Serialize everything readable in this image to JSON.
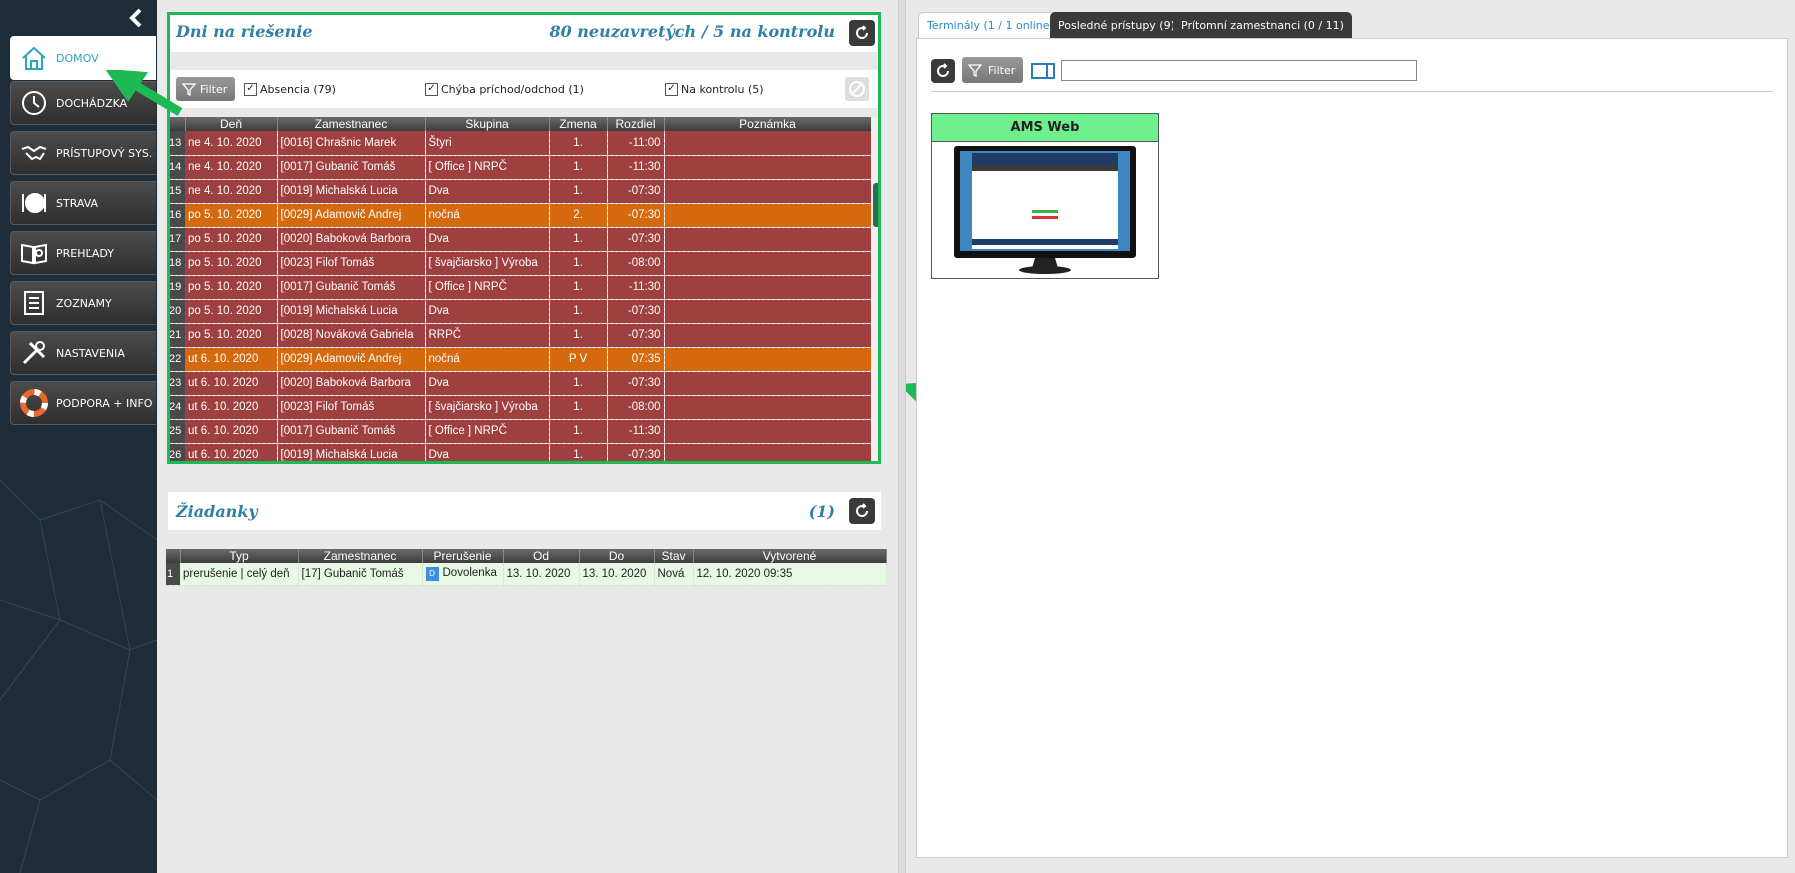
{
  "sidebar": {
    "items": [
      {
        "label": "DOMOV",
        "icon": "home-icon"
      },
      {
        "label": "DOCHÁDZKA",
        "icon": "clock-icon"
      },
      {
        "label": "PRÍSTUPOVÝ SYS.",
        "icon": "handshake-icon"
      },
      {
        "label": "STRAVA",
        "icon": "plate-icon"
      },
      {
        "label": "PREHĽADY",
        "icon": "book-search-icon"
      },
      {
        "label": "ZOZNAMY",
        "icon": "list-icon"
      },
      {
        "label": "NASTAVENIA",
        "icon": "tools-icon"
      },
      {
        "label": "PODPORA + INFO",
        "icon": "lifebuoy-icon"
      }
    ]
  },
  "days": {
    "title": "Dni na riešenie",
    "summary": "80 neuzavretých / 5 na kontrolu",
    "filter_label": "Filter",
    "checks": [
      {
        "label": "Absencia (79)",
        "checked": true
      },
      {
        "label": "Chýba príchod/odchod (1)",
        "checked": true
      },
      {
        "label": "Na kontrolu (5)",
        "checked": true
      }
    ],
    "columns": [
      "Deň",
      "Zamestnanec",
      "Skupina",
      "Zmena",
      "Rozdiel",
      "Poznámka"
    ],
    "rows": [
      {
        "n": "13",
        "day": "ne 4. 10. 2020",
        "emp": "[0016] Chrašnic Marek",
        "group": "Štyri",
        "shift": "1.",
        "diff": "-11:00",
        "note": "",
        "color": "red"
      },
      {
        "n": "14",
        "day": "ne 4. 10. 2020",
        "emp": "[0017] Gubanič Tomáš",
        "group": "[ Office ]  NRPČ",
        "shift": "1.",
        "diff": "-11:30",
        "note": "",
        "color": "red"
      },
      {
        "n": "15",
        "day": "ne 4. 10. 2020",
        "emp": "[0019] Michalská Lucia",
        "group": "Dva",
        "shift": "1.",
        "diff": "-07:30",
        "note": "",
        "color": "red"
      },
      {
        "n": "16",
        "day": "po 5. 10. 2020",
        "emp": "[0029] Adamovič Andrej",
        "group": "nočná",
        "shift": "2.",
        "diff": "-07:30",
        "note": "",
        "color": "orange"
      },
      {
        "n": "17",
        "day": "po 5. 10. 2020",
        "emp": "[0020] Baboková Barbora",
        "group": "Dva",
        "shift": "1.",
        "diff": "-07:30",
        "note": "",
        "color": "red"
      },
      {
        "n": "18",
        "day": "po 5. 10. 2020",
        "emp": "[0023] Filof Tomáš",
        "group": "[ švajčiarsko ]  Výroba",
        "shift": "1.",
        "diff": "-08:00",
        "note": "",
        "color": "red"
      },
      {
        "n": "19",
        "day": "po 5. 10. 2020",
        "emp": "[0017] Gubanič Tomáš",
        "group": "[ Office ]  NRPČ",
        "shift": "1.",
        "diff": "-11:30",
        "note": "",
        "color": "red"
      },
      {
        "n": "20",
        "day": "po 5. 10. 2020",
        "emp": "[0019] Michalská Lucia",
        "group": "Dva",
        "shift": "1.",
        "diff": "-07:30",
        "note": "",
        "color": "red"
      },
      {
        "n": "21",
        "day": "po 5. 10. 2020",
        "emp": "[0028] Nováková Gabriela",
        "group": "RRPČ",
        "shift": "1.",
        "diff": "-07:30",
        "note": "",
        "color": "red"
      },
      {
        "n": "22",
        "day": "ut 6. 10. 2020",
        "emp": "[0029] Adamovič Andrej",
        "group": "nočná",
        "shift": "P V",
        "diff": "07:35",
        "note": "",
        "color": "orange"
      },
      {
        "n": "23",
        "day": "ut 6. 10. 2020",
        "emp": "[0020] Baboková Barbora",
        "group": "Dva",
        "shift": "1.",
        "diff": "-07:30",
        "note": "",
        "color": "red"
      },
      {
        "n": "24",
        "day": "ut 6. 10. 2020",
        "emp": "[0023] Filof Tomáš",
        "group": "[ švajčiarsko ]  Výroba",
        "shift": "1.",
        "diff": "-08:00",
        "note": "",
        "color": "red"
      },
      {
        "n": "25",
        "day": "ut 6. 10. 2020",
        "emp": "[0017] Gubanič Tomáš",
        "group": "[ Office ]  NRPČ",
        "shift": "1.",
        "diff": "-11:30",
        "note": "",
        "color": "red"
      },
      {
        "n": "26",
        "day": "ut 6. 10. 2020",
        "emp": "[0019] Michalská Lucia",
        "group": "Dva",
        "shift": "1.",
        "diff": "-07:30",
        "note": "",
        "color": "red"
      }
    ]
  },
  "requests": {
    "title": "Žiadanky",
    "count": "(1)",
    "columns": [
      "Typ",
      "Zamestnanec",
      "Prerušenie",
      "Od",
      "Do",
      "Stav",
      "Vytvorené"
    ],
    "rows": [
      {
        "n": "1",
        "type": "prerušenie | celý deň",
        "emp": "[17] Gubanič Tomáš",
        "badge": "D",
        "interruption": "Dovolenka",
        "from": "13. 10. 2020",
        "to": "13. 10. 2020",
        "state": "Nová",
        "created": "12. 10. 2020  09:35"
      }
    ]
  },
  "right": {
    "tabs": [
      "Terminály (1 / 1 online)",
      "Posledné prístupy (9)",
      "Prítomní zamestnanci (0 / 11)"
    ],
    "filter_label": "Filter",
    "search_value": "",
    "terminal_name": "AMS Web"
  },
  "colors": {
    "sidebar": "#1f2d38",
    "row_red": "#9e3f40",
    "row_orange": "#d4690e",
    "accent": "#2aa3c0",
    "highlight": "#1db954"
  }
}
